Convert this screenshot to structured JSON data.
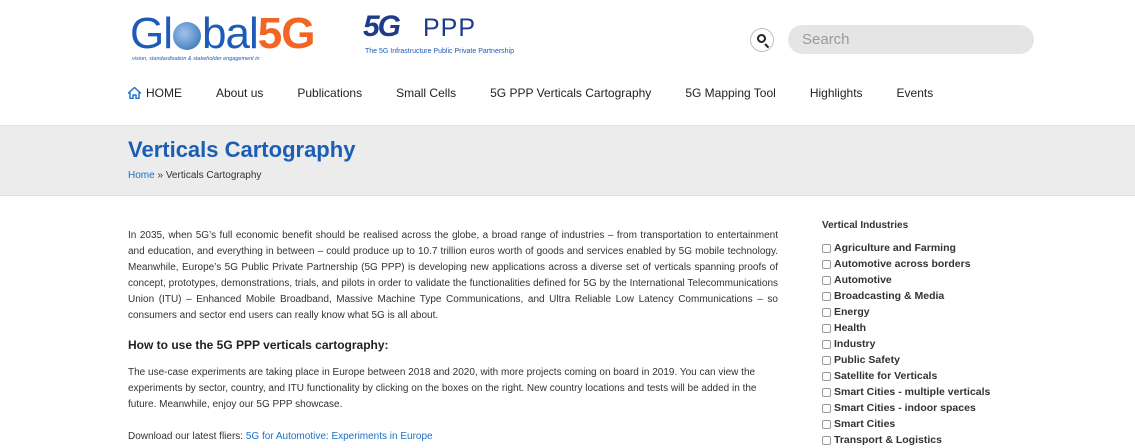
{
  "header": {
    "global5g_logo": {
      "word": "Gl",
      "word_end": "bal",
      "accent": "5G",
      "tagline": "vision, standardisation & stakeholder engagement in"
    },
    "ppp_logo": {
      "mark": "5G",
      "text": "PPP",
      "subtitle": "The 5G Infrastructure Public Private Partnership"
    },
    "search": {
      "placeholder": "Search"
    },
    "nav": {
      "home": "HOME",
      "items": [
        "About us",
        "Publications",
        "Small Cells",
        "5G PPP Verticals Cartography",
        "5G Mapping Tool",
        "Highlights",
        "Events"
      ]
    }
  },
  "page": {
    "title": "Verticals Cartography",
    "breadcrumb": {
      "home": "Home",
      "separator": "»",
      "current": "Verticals Cartography"
    }
  },
  "main": {
    "intro": "In 2035, when 5G’s full economic benefit should be realised across the globe, a broad range of industries – from transportation to entertainment and education, and everything in between – could produce up to 10.7 trillion euros worth of goods and services enabled by 5G mobile technology. Meanwhile, Europe’s 5G Public Private Partnership (5G PPP) is developing new applications across a diverse set of verticals spanning proofs of concept, prototypes, demonstrations, trials, and pilots in order to validate the functionalities defined for 5G by the International Telecommunications Union (ITU) – Enhanced Mobile Broadband, Massive Machine Type Communications, and Ultra Reliable Low Latency Communications – so consumers and sector end users can really know what 5G is all about.",
    "howto_heading": "How to use the 5G PPP verticals cartography:",
    "howto_text": "The use-case experiments are taking place in Europe between 2018 and 2020, with more projects coming on board in 2019. You can view the experiments by sector, country, and ITU functionality by clicking on the boxes on the right. New country locations and tests will be added in the future. Meanwhile, enjoy our 5G PPP showcase.",
    "download_prefix": "Download our latest fliers: ",
    "download_link": "5G for Automotive: Experiments in Europe"
  },
  "sidebar": {
    "heading": "Vertical Industries",
    "items": [
      "Agriculture and Farming",
      "Automotive across borders",
      "Automotive",
      "Broadcasting & Media",
      "Energy",
      "Health",
      "Industry",
      "Public Safety",
      "Satellite for Verticals",
      "Smart Cities - multiple verticals",
      "Smart Cities - indoor spaces",
      "Smart Cities",
      "Transport & Logistics"
    ]
  },
  "colors": {
    "accent_blue": "#1a5fb4",
    "link_blue": "#1a6fc9",
    "logo_orange": "#f26522",
    "band_gray": "#ececec"
  }
}
